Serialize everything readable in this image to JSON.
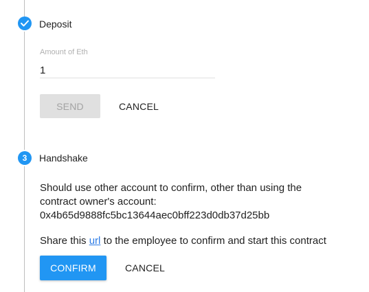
{
  "deposit": {
    "title": "Deposit",
    "amount_label": "Amount of Eth",
    "amount_value": "1",
    "send_label": "SEND",
    "cancel_label": "CANCEL"
  },
  "handshake": {
    "step_number": "3",
    "title": "Handshake",
    "message_line1": "Should use other account to confirm, other than using the",
    "message_line2": "contract owner's account:",
    "address": "0x4b65d9888fc5bc13644aec0bff223d0db37d25bb",
    "share_prefix": "Share this",
    "share_link": "url",
    "share_suffix": "to the employee to confirm and start this contract",
    "confirm_label": "CONFIRM",
    "cancel_label": "CANCEL"
  },
  "colors": {
    "accent": "#2196f3",
    "link": "#2c7be5",
    "disabled_bg": "#e0e0e0",
    "rail": "#bdbdbd"
  },
  "icons": {
    "deposit_step": "check-icon"
  }
}
